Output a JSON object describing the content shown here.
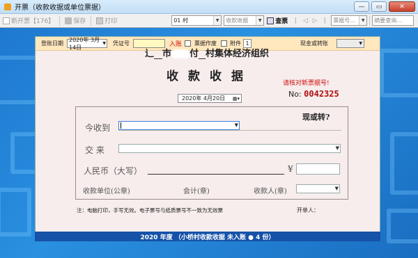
{
  "window": {
    "title": "开票（收款收据或单位票据）"
  },
  "toolbar": {
    "new_invoice": "新开票【176】",
    "save": "保存",
    "print": "打印",
    "village_select": "01      村",
    "receipt_type": "收款收据",
    "search_btn": "查票",
    "ticket_no_placeholder": "票据号...",
    "summary_query": "摘要查询..."
  },
  "form": {
    "entry_date_label": "登账日期",
    "entry_date_value": "2020年 3月14日",
    "voucher_label": "凭证号",
    "posted_label": "入账",
    "void_label": "票据作废",
    "attachment_label": "附件",
    "attachment_value": "1",
    "cash_or_transfer_label": "现金或转账",
    "org_name_prefix": "辶",
    "org_name_city": "市",
    "org_name_village": "付",
    "org_name_suffix": "村集体经济组织",
    "doc_title": "收款收据",
    "red_tip": "请核对新票据号!",
    "no_label": "No:",
    "ticket_no": "0042325",
    "date_value": "2020年 4月20日",
    "cash_transfer_q": "现或转?",
    "received_from_label": "今收到",
    "payment_label": "交    来",
    "rmb_label": "人民币（大写）",
    "yen": "¥",
    "unit_seal_label": "收款单位(公章)",
    "accountant_label": "会计(章)",
    "payee_label": "收款人(章)",
    "note": "注：电脑打印，手写无效。电子票号与纸质票号不一致为无效票",
    "issuer_label": "开单人："
  },
  "footer": {
    "summary": "2020 年度 （小桥村收款收据 未入账 ● 4 份）"
  }
}
